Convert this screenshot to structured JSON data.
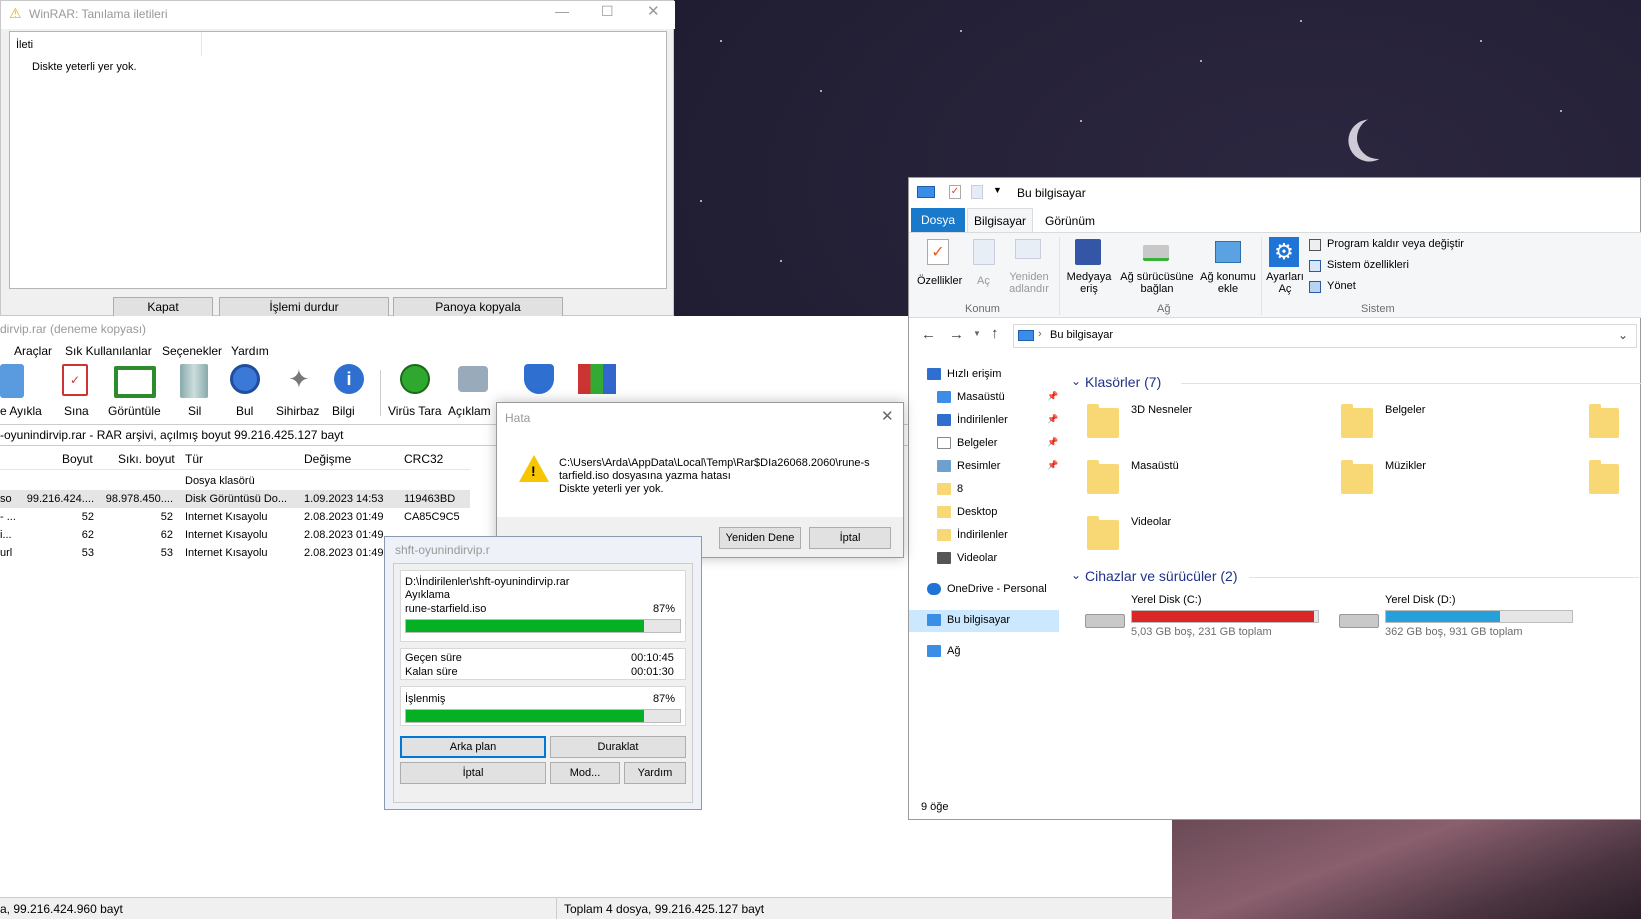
{
  "diag": {
    "title": "WinRAR: Tanılama iletileri",
    "col": "İleti",
    "message": "Diskte yeterli yer yok.",
    "buttons": [
      "Kapat",
      "İşlemi durdur",
      "Panoya kopyala"
    ]
  },
  "winrar": {
    "title": "dirvip.rar (deneme kopyası)",
    "menu": [
      "Araçlar",
      "Sık Kullanılanlar",
      "Seçenekler",
      "Yardım"
    ],
    "toolbar": [
      "e Ayıkla",
      "Sına",
      "Görüntüle",
      "Sil",
      "Bul",
      "Sihirbaz",
      "Bilgi",
      "Virüs Tara",
      "Açıklam"
    ],
    "path": "-oyunindirvip.rar - RAR arşivi, açılmış boyut 99.216.425.127 bayt",
    "columns": [
      "Boyut",
      "Sıkı. boyut",
      "Tür",
      "Değişme",
      "CRC32"
    ],
    "rows": [
      {
        "name": "",
        "size": "",
        "packed": "",
        "type": "Dosya klasörü",
        "modified": "",
        "crc": ""
      },
      {
        "name": "so",
        "size": "99.216.424....",
        "packed": "98.978.450....",
        "type": "Disk Görüntüsü Do...",
        "modified": "1.09.2023 14:53",
        "crc": "119463BD"
      },
      {
        "name": "- ...",
        "size": "52",
        "packed": "52",
        "type": "Internet Kısayolu",
        "modified": "2.08.2023 01:49",
        "crc": "CA85C9C5"
      },
      {
        "name": "i...",
        "size": "62",
        "packed": "62",
        "type": "Internet Kısayolu",
        "modified": "2.08.2023 01:49",
        "crc": ""
      },
      {
        "name": "url",
        "size": "53",
        "packed": "53",
        "type": "Internet Kısayolu",
        "modified": "2.08.2023 01:49",
        "crc": ""
      }
    ],
    "status_left": "a, 99.216.424.960 bayt",
    "status_right": "Toplam 4 dosya, 99.216.425.127 bayt"
  },
  "error": {
    "title": "Hata",
    "message_lines": [
      "C:\\Users\\Arda\\AppData\\Local\\Temp\\Rar$DIa26068.2060\\rune-s",
      "tarfield.iso dosyasına yazma hatası",
      "Diskte yeterli yer yok."
    ],
    "retry": "Yeniden Dene",
    "cancel": "İptal"
  },
  "progress": {
    "title": "shft-oyunindirvip.r",
    "archive": "D:\\İndirilenler\\shft-oyunindirvip.rar",
    "action": "Ayıklama",
    "file": "rune-starfield.iso",
    "file_pct": "87%",
    "file_frac": 0.87,
    "elapsed_label": "Geçen süre",
    "elapsed": "00:10:45",
    "remaining_label": "Kalan süre",
    "remaining": "00:01:30",
    "processed_label": "İşlenmiş",
    "processed_pct": "87%",
    "processed_frac": 0.87,
    "buttons": [
      "Arka plan",
      "Duraklat",
      "İptal",
      "Mod...",
      "Yardım"
    ]
  },
  "explorer": {
    "title": "Bu bilgisayar",
    "tabs": [
      "Dosya",
      "Bilgisayar",
      "Görünüm"
    ],
    "ribbon": {
      "konum": [
        "Özellikler",
        "Aç",
        "Yeniden adlandır"
      ],
      "konum_label": "Konum",
      "ag": [
        "Medyaya eriş",
        "Ağ sürücüsüne bağlan",
        "Ağ konumu ekle"
      ],
      "ag_label": "Ağ",
      "ayarlar": "Ayarları Aç",
      "sistem": [
        "Program kaldır veya değiştir",
        "Sistem özellikleri",
        "Yönet"
      ],
      "sistem_label": "Sistem"
    },
    "address": "Bu bilgisayar",
    "nav": [
      "Hızlı erişim",
      "Masaüstü",
      "İndirilenler",
      "Belgeler",
      "Resimler",
      "8",
      "Desktop",
      "İndirilenler",
      "Videolar",
      "OneDrive - Personal",
      "Bu bilgisayar",
      "Ağ"
    ],
    "folders_header": "Klasörler (7)",
    "folders": [
      "3D Nesneler",
      "Belgeler",
      "Masaüstü",
      "Müzikler",
      "Videolar"
    ],
    "devices_header": "Cihazlar ve sürücüler (2)",
    "drives": [
      {
        "name": "Yerel Disk (C:)",
        "info": "5,03 GB boş, 231 GB toplam",
        "used_frac": 0.978,
        "color": "#da2626"
      },
      {
        "name": "Yerel Disk (D:)",
        "info": "362 GB boş, 931 GB toplam",
        "used_frac": 0.611,
        "color": "#26a0da"
      }
    ],
    "status": "9 öğe"
  }
}
